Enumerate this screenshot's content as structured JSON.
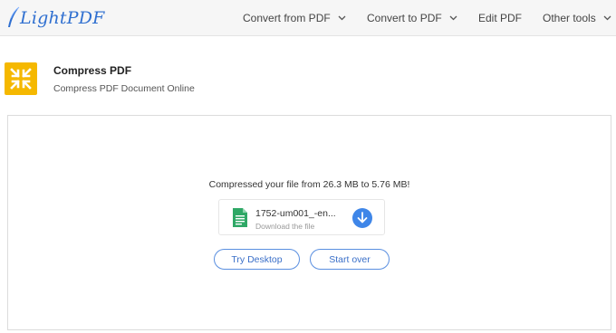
{
  "header": {
    "logo_text": "LightPDF",
    "nav": [
      {
        "label": "Convert from PDF",
        "has_dropdown": true
      },
      {
        "label": "Convert to PDF",
        "has_dropdown": true
      },
      {
        "label": "Edit PDF",
        "has_dropdown": false
      },
      {
        "label": "Other tools",
        "has_dropdown": true
      }
    ]
  },
  "tool": {
    "title": "Compress PDF",
    "subtitle": "Compress PDF Document Online",
    "icon": "compress-arrows-icon",
    "icon_color": "#f5b800"
  },
  "result": {
    "message": "Compressed your file from 26.3 MB to 5.76 MB!",
    "file": {
      "name": "1752-um001_-en...",
      "download_label": "Download the file",
      "icon": "document-icon",
      "icon_color": "#2fa866"
    },
    "download_icon": "download-arrow-icon",
    "buttons": {
      "try_desktop": "Try Desktop",
      "start_over": "Start over"
    }
  },
  "colors": {
    "accent": "#3f86e8",
    "brand": "#2f6fd0"
  }
}
